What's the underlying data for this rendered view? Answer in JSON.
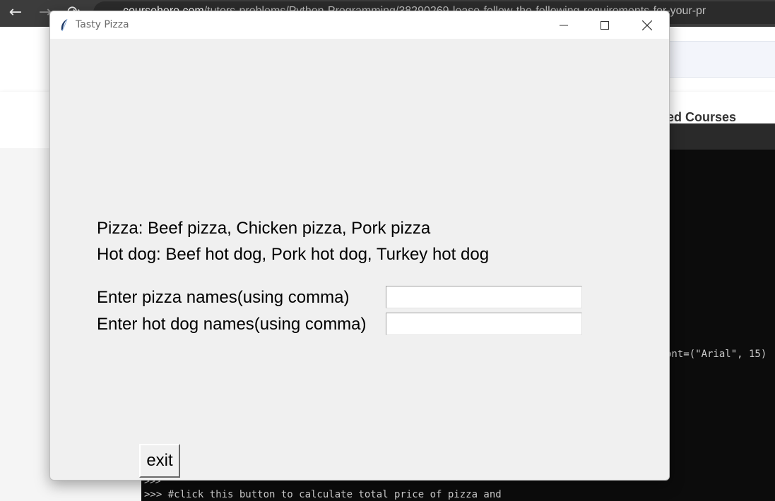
{
  "browser": {
    "url_host": "coursehero.com",
    "url_path": "/tutors-problems/Python-Programming/38290269-lease-follow-the-following-requirements-for-your-pr",
    "back_icon": "arrow-left",
    "forward_icon": "arrow-right",
    "reload_icon": "reload",
    "page_partial_text": "ted Courses"
  },
  "terminal": {
    "line_code": "ont=(\"Arial\", 15)",
    "line_prompt": ">>>",
    "line_comment": ">>> #click this button to calculate total price of pizza and"
  },
  "window": {
    "title": "Tasty Pizza",
    "icon": "feather-icon",
    "controls": {
      "minimize": "minimize-icon",
      "maximize": "maximize-icon",
      "close": "close-icon"
    }
  },
  "menu": {
    "pizza_line": "Pizza: Beef pizza, Chicken pizza, Pork pizza",
    "hotdog_line": "Hot dog: Beef hot dog, Pork hot dog, Turkey hot dog"
  },
  "form": {
    "pizza_label": "Enter pizza names(using comma)",
    "pizza_value": "",
    "hotdog_label": "Enter hot dog names(using comma)",
    "hotdog_value": ""
  },
  "buttons": {
    "exit_label": "exit"
  }
}
